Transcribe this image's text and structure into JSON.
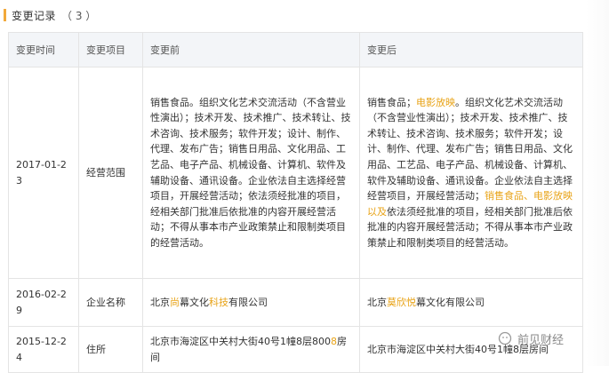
{
  "section": {
    "title": "变更记录",
    "count": "（ 3 ）",
    "accent_color": "#f2a93b"
  },
  "table": {
    "headers": [
      "变更时间",
      "变更项目",
      "变更前",
      "变更后"
    ],
    "rows": [
      {
        "date": "2017-01-23",
        "item": "经营范围",
        "before": "销售食品。组织文化艺术交流活动（不含营业性演出）；技术开发、技术推广、技术转让、技术咨询、技术服务；软件开发；设计、制作、代理、发布广告；销售日用品、文化用品、工艺品、电子产品、机械设备、计算机、软件及辅助设备、通讯设备。企业依法自主选择经营项目，开展经营活动；依法须经批准的项目，经相关部门批准后依批准的内容开展经营活动；不得从事本市产业政策禁止和限制类项目的经营活动。",
        "after_parts": [
          {
            "text": "销售食品；",
            "hl": false
          },
          {
            "text": "电影放映",
            "hl": true
          },
          {
            "text": "。组织文化艺术交流活动（不含营业性演出）；技术开发、技术推广、技术转让、技术咨询、技术服务；软件开发；设计、制作、代理、发布广告；销售日用品、文化用品、工艺品、电子产品、机械设备、计算机、软件及辅助设备、通讯设备。企业依法自主选择经营项目，开展经营活动；",
            "hl": false
          },
          {
            "text": "销售食品、电影放映以及",
            "hl": true
          },
          {
            "text": "依法须经批准的项目，经相关部门批准后依批准的内容开展经营活动；不得从事本市产业政策禁止和限制类项目的经营活动。",
            "hl": false
          }
        ]
      },
      {
        "date": "2016-02-29",
        "item": "企业名称",
        "before_parts": [
          {
            "text": "北京",
            "hl": false
          },
          {
            "text": "尚",
            "hl": true
          },
          {
            "text": "幕文化",
            "hl": false
          },
          {
            "text": "科技",
            "hl": true
          },
          {
            "text": "有限公司",
            "hl": false
          }
        ],
        "after_parts": [
          {
            "text": "北京",
            "hl": false
          },
          {
            "text": "莫欣悦",
            "hl": true
          },
          {
            "text": "幕文化有限公司",
            "hl": false
          }
        ]
      },
      {
        "date": "2015-12-24",
        "item": "住所",
        "before_parts": [
          {
            "text": "北京市海淀区中关村大街40号1幢8层800",
            "hl": false
          },
          {
            "text": "8",
            "hl": true
          },
          {
            "text": "房间",
            "hl": false
          }
        ],
        "after_parts": [
          {
            "text": "北京市海淀区中关村大街40号1幢8层",
            "hl": false
          },
          {
            "text": "房间",
            "hl": false
          }
        ]
      }
    ]
  },
  "watermark": {
    "text": "前见财经"
  }
}
